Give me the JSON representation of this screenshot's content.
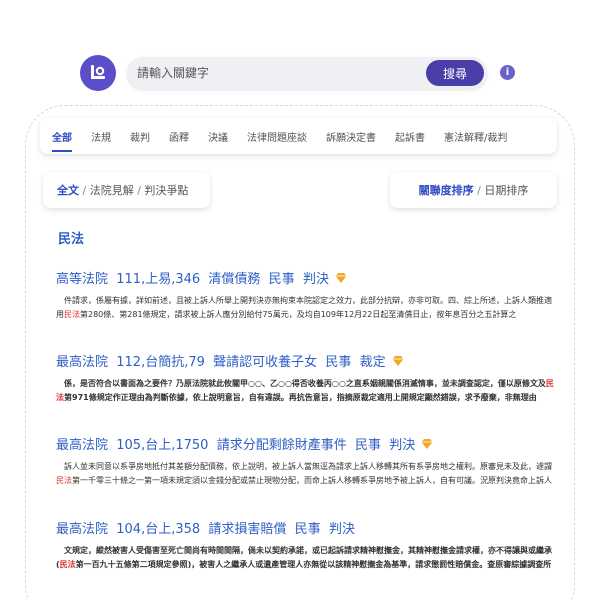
{
  "header": {
    "logo_text": "Lo",
    "search_placeholder": "請輸入關鍵字",
    "search_button": "搜尋",
    "info_icon": "i"
  },
  "tabs": [
    "全部",
    "法規",
    "裁判",
    "函釋",
    "決議",
    "法律問題座談",
    "訴願決定書",
    "起訴書",
    "憲法解釋/裁判"
  ],
  "filters": {
    "left": [
      "全文",
      "法院見解",
      "判決爭點"
    ],
    "right": [
      "關聯度排序",
      "日期排序"
    ],
    "separator": " / "
  },
  "section_title": "民法",
  "results": [
    {
      "title": "高等法院  111,上易,346  清償債務  民事  判決",
      "diamond": true,
      "bold": false,
      "body_before": "　件請求，係屬有據，詳如前述，且被上訴人所舉上開判決亦無拘束本院認定之效力，此部分抗辯，亦非可取。四、綜上所述，上訴人類推適用",
      "highlight": "民法",
      "body_after": "第280條、第281條規定，請求被上訴人應分別給付75萬元，及均自109年12月22日起至清償日止，按年息百分之五計算之"
    },
    {
      "title": "最高法院  112,台簡抗,79  聲請認可收養子女  民事  裁定",
      "diamond": true,
      "bold": true,
      "body_before": "　係，是否符合以書面為之要件？乃原法院就此攸關甲○○、乙○○得否收養丙○○之直系姻親關係消滅情事，並未調查認定，僅以原條文及",
      "highlight": "民法",
      "body_after": "第971條規定作正理由為判斷依據，依上說明意旨，自有違誤。再抗告意旨，指摘原裁定適用上開規定顯然錯誤，求予廢棄，非無理由"
    },
    {
      "title": "最高法院  105,台上,1750  請求分配剩餘財產事件  民事  判決",
      "diamond": true,
      "bold": false,
      "body_before": "　訴人並未同意以系爭房地抵付其差額分配債務，依上說明，被上訴人當無逕為請求上訴人移轉其所有系爭房地之權利。原審見未及此，遽謂",
      "highlight": "民法",
      "body_after": "第一千零三十條之一第一項未規定須以金錢分配或禁止現物分配，而命上訴人移轉系爭房地予被上訴人，自有可議。況原判決竟命上訴人"
    },
    {
      "title": "最高法院  104,台上,358  請求損害賠償  民事  判決",
      "diamond": false,
      "bold": true,
      "body_before": "　文規定，縱然被害人受傷害至死亡間尚有時間間隔，倘未以契約承諾，或已起訴請求精神慰撫金，其精神慰撫金請求權，亦不得讓與或繼承(",
      "highlight": "民法",
      "body_after": "第一百九十五條第二項規定參照)，被害人之繼承人或遺產管理人亦無從以該精神慰撫金為基準，請求懲罰性賠償金。查原審綜據調查所"
    }
  ],
  "colors": {
    "accent": "#4a3fa8",
    "link": "#2f5fc4",
    "highlight": "#e0302b",
    "diamond": "#f5a623"
  }
}
